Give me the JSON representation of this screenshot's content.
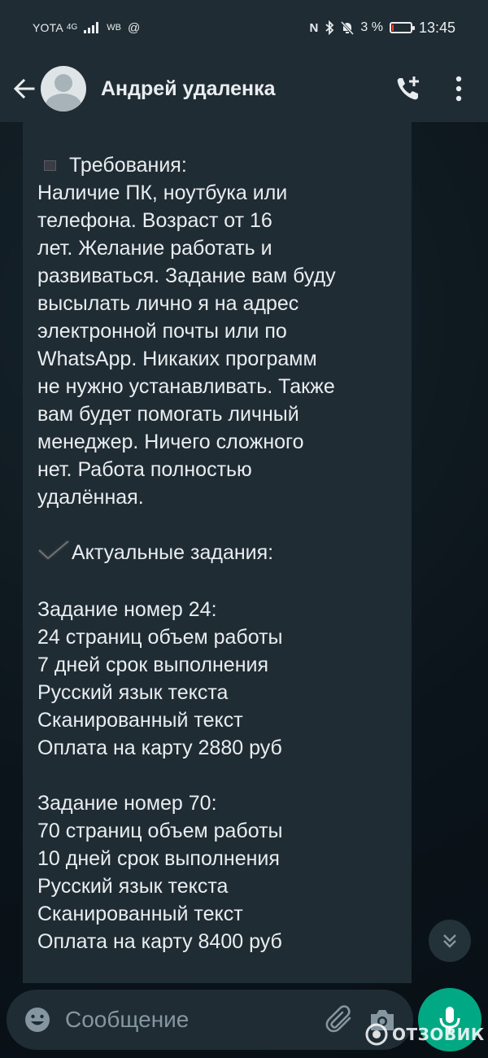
{
  "status_bar": {
    "carrier": "YOTA",
    "network": "4G",
    "extra": "WB",
    "battery_percent": "3 %",
    "battery_level": 0.03,
    "time": "13:45"
  },
  "header": {
    "contact_name": "Андрей удаленка"
  },
  "message": {
    "lines": [
      "Требования:",
      "Наличие ПК, ноутбука или",
      "телефона. Возраст от 16",
      "лет. Желание работать и",
      "развиваться. Задание вам буду",
      "высылать лично я на адрес",
      "электронной почты или по",
      "WhatsApp. Никаких программ",
      "не нужно устанавливать. Также",
      "вам будет помогать личный",
      "менеджер. Ничего сложного",
      "нет. Работа полностью",
      "удалённая.",
      "",
      "Актуальные задания:",
      "",
      "Задание номер 24:",
      "24 страниц объем работы",
      "7 дней срок выполнения",
      "Русский язык текста",
      "Сканированный текст",
      "Оплата на карту 2880 руб",
      "",
      "Задание номер 70:",
      "70 страниц объем работы",
      "10 дней срок выполнения",
      "Русский язык текста",
      "Сканированный текст",
      "Оплата на карту 8400 руб"
    ]
  },
  "input": {
    "placeholder": "Сообщение"
  },
  "watermark": {
    "text": "ОТЗОВИК"
  },
  "icons": {
    "back": "arrow-left-icon",
    "call": "add-call-icon",
    "menu": "more-vertical-icon",
    "emoji": "emoji-icon",
    "attach": "paperclip-icon",
    "camera": "camera-icon",
    "mic": "microphone-icon",
    "scroll": "double-chevron-down-icon"
  },
  "colors": {
    "header": "#1f2c34",
    "accent": "#00a884",
    "bubble": "#1f2c34",
    "text": "#e9edef",
    "placeholder": "#8696a0"
  }
}
